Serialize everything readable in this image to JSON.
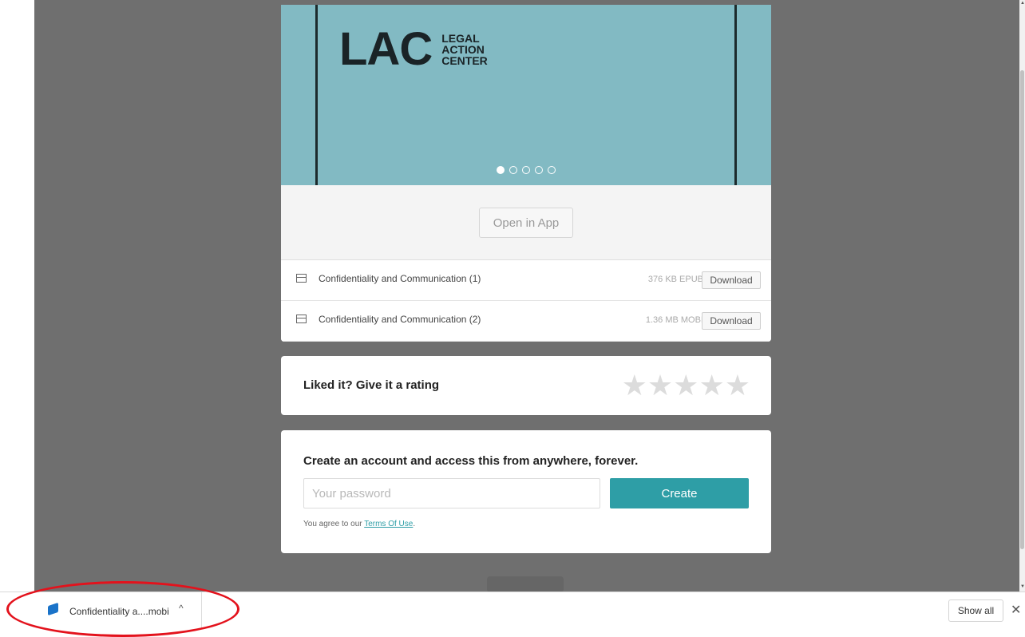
{
  "cover": {
    "logo_mark": "LAC",
    "logo_lines": [
      "LEGAL",
      "ACTION",
      "CENTER"
    ],
    "carousel_total": 5,
    "carousel_active": 1
  },
  "open_in_app_label": "Open in App",
  "files": [
    {
      "name": "Confidentiality and Communication (1)",
      "size": "376 KB EPUB",
      "action": "Download"
    },
    {
      "name": "Confidentiality and Communication (2)",
      "size": "1.36 MB MOBI",
      "action": "Download"
    }
  ],
  "rating": {
    "title": "Liked it? Give it a rating",
    "stars": 5
  },
  "account": {
    "title": "Create an account and access this from anywhere, forever.",
    "password_placeholder": "Your password",
    "create_label": "Create",
    "terms_prefix": "You agree to our ",
    "terms_link": "Terms Of Use",
    "terms_suffix": "."
  },
  "download_bar": {
    "file_name": "Confidentiality a....mobi",
    "show_all_label": "Show all",
    "close_glyph": "✕",
    "chevron_glyph": "^"
  },
  "colors": {
    "cover_bg": "#82bac3",
    "accent": "#2e9ea6",
    "annotation": "#e3121c"
  }
}
